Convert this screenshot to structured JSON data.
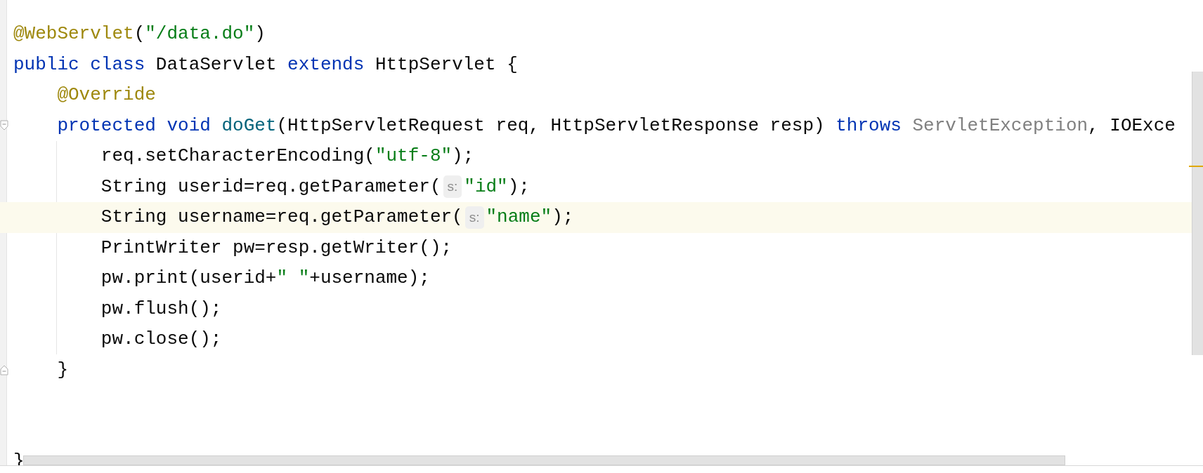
{
  "editor": {
    "lines": [
      {
        "kind": "code",
        "highlighted": false,
        "tokens": [
          {
            "kind": "annotation",
            "text": "@WebServlet"
          },
          {
            "kind": "plain",
            "text": "("
          },
          {
            "kind": "string",
            "text": "\"/data.do\""
          },
          {
            "kind": "plain",
            "text": ")"
          }
        ]
      },
      {
        "kind": "code",
        "highlighted": false,
        "tokens": [
          {
            "kind": "keyword",
            "text": "public"
          },
          {
            "kind": "keyword",
            "text": " class"
          },
          {
            "kind": "plain",
            "text": " DataServlet"
          },
          {
            "kind": "keyword",
            "text": " extends"
          },
          {
            "kind": "plain",
            "text": " HttpServlet {"
          }
        ]
      },
      {
        "kind": "code",
        "highlighted": false,
        "tokens": [
          {
            "kind": "annotation",
            "text": "    @Override"
          }
        ]
      },
      {
        "kind": "code",
        "highlighted": false,
        "fold": {
          "kind": "start"
        },
        "tokens": [
          {
            "kind": "keyword",
            "text": "    protected"
          },
          {
            "kind": "keyword",
            "text": " void"
          },
          {
            "kind": "method",
            "text": " doGet"
          },
          {
            "kind": "plain",
            "text": "(HttpServletRequest req, HttpServletResponse resp)"
          },
          {
            "kind": "keyword",
            "text": " throws"
          },
          {
            "kind": "unresolved",
            "text": " ServletException"
          },
          {
            "kind": "plain",
            "text": ", IOExce"
          }
        ]
      },
      {
        "kind": "code",
        "highlighted": false,
        "tokens": [
          {
            "kind": "plain",
            "text": "        req.setCharacterEncoding("
          },
          {
            "kind": "string",
            "text": "\"utf-8\""
          },
          {
            "kind": "plain",
            "text": ");"
          }
        ]
      },
      {
        "kind": "code",
        "highlighted": false,
        "tokens": [
          {
            "kind": "plain",
            "text": "        String userid=req.getParameter("
          },
          {
            "kind": "hint",
            "text": "s:"
          },
          {
            "kind": "string",
            "text": "\"id\""
          },
          {
            "kind": "plain",
            "text": ");"
          }
        ]
      },
      {
        "kind": "code",
        "highlighted": true,
        "tokens": [
          {
            "kind": "plain",
            "text": "        String username=req.getParameter("
          },
          {
            "kind": "hint",
            "text": "s:"
          },
          {
            "kind": "string",
            "text": "\"name\""
          },
          {
            "kind": "plain",
            "text": ");"
          }
        ]
      },
      {
        "kind": "code",
        "highlighted": false,
        "tokens": [
          {
            "kind": "plain",
            "text": "        PrintWriter pw=resp.getWriter();"
          }
        ]
      },
      {
        "kind": "code",
        "highlighted": false,
        "tokens": [
          {
            "kind": "plain",
            "text": "        pw.print(userid+"
          },
          {
            "kind": "string",
            "text": "\" \""
          },
          {
            "kind": "plain",
            "text": "+username);"
          }
        ]
      },
      {
        "kind": "code",
        "highlighted": false,
        "tokens": [
          {
            "kind": "plain",
            "text": "        pw.flush();"
          }
        ]
      },
      {
        "kind": "code",
        "highlighted": false,
        "tokens": [
          {
            "kind": "plain",
            "text": "        pw.close();"
          }
        ]
      },
      {
        "kind": "code",
        "highlighted": false,
        "fold": {
          "kind": "end"
        },
        "tokens": [
          {
            "kind": "plain",
            "text": "    }"
          }
        ]
      },
      {
        "kind": "blank",
        "highlighted": false
      },
      {
        "kind": "blank",
        "highlighted": false
      },
      {
        "kind": "code",
        "highlighted": false,
        "tokens": [
          {
            "kind": "plain",
            "text": "}"
          }
        ]
      }
    ]
  }
}
